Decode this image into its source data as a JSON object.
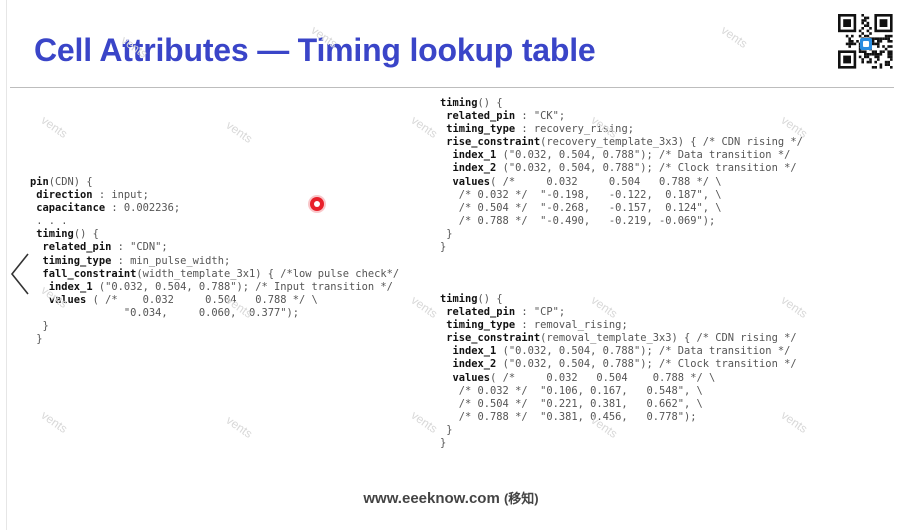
{
  "title": "Cell Attributes — Timing lookup table",
  "footer": {
    "site": "www.eeeknow.com",
    "cn": "(移知)"
  },
  "watermark_text": "vents",
  "left_block": [
    [
      {
        "k": "pin"
      },
      {
        "t": "(CDN) {"
      }
    ],
    [
      {
        "t": " "
      },
      {
        "k": "direction"
      },
      {
        "t": " : input;"
      }
    ],
    [
      {
        "t": " "
      },
      {
        "k": "capacitance"
      },
      {
        "t": " : 0.002236;"
      }
    ],
    [
      {
        "t": " . . ."
      }
    ],
    [
      {
        "t": " "
      },
      {
        "k": "timing"
      },
      {
        "t": "() {"
      }
    ],
    [
      {
        "t": "  "
      },
      {
        "k": "related_pin"
      },
      {
        "t": " : \"CDN\";"
      }
    ],
    [
      {
        "t": "  "
      },
      {
        "k": "timing_type"
      },
      {
        "t": " : min_pulse_width;"
      }
    ],
    [
      {
        "t": "  "
      },
      {
        "k": "fall_constraint"
      },
      {
        "t": "(width_template_3x1) { /*low pulse check*/"
      }
    ],
    [
      {
        "t": "   "
      },
      {
        "k": "index_1"
      },
      {
        "t": " (\"0.032, 0.504, 0.788\"); /* Input transition */"
      }
    ],
    [
      {
        "t": "   "
      },
      {
        "k": "values"
      },
      {
        "t": " ( /*    0.032     0.504   0.788 */ \\"
      }
    ],
    [
      {
        "t": "               \"0.034,     0.060,  0.377\");"
      }
    ],
    [
      {
        "t": "  }"
      }
    ],
    [
      {
        "t": " }"
      }
    ]
  ],
  "right_top_block": [
    [
      {
        "k": "timing"
      },
      {
        "t": "() {"
      }
    ],
    [
      {
        "t": " "
      },
      {
        "k": "related_pin"
      },
      {
        "t": " : \"CK\";"
      }
    ],
    [
      {
        "t": " "
      },
      {
        "k": "timing_type"
      },
      {
        "t": " : recovery_rising;"
      }
    ],
    [
      {
        "t": " "
      },
      {
        "k": "rise_constraint"
      },
      {
        "t": "(recovery_template_3x3) { /* CDN rising */"
      }
    ],
    [
      {
        "t": "  "
      },
      {
        "k": "index_1"
      },
      {
        "t": " (\"0.032, 0.504, 0.788\"); /* Data transition */"
      }
    ],
    [
      {
        "t": "  "
      },
      {
        "k": "index_2"
      },
      {
        "t": " (\"0.032, 0.504, 0.788\"); /* Clock transition */"
      }
    ],
    [
      {
        "t": "  "
      },
      {
        "k": "values"
      },
      {
        "t": "( /*     0.032     0.504   0.788 */ \\"
      }
    ],
    [
      {
        "t": "   /* 0.032 */  \"-0.198,   -0.122,  0.187\", \\"
      }
    ],
    [
      {
        "t": "   /* 0.504 */  \"-0.268,   -0.157,  0.124\", \\"
      }
    ],
    [
      {
        "t": "   /* 0.788 */  \"-0.490,   -0.219, -0.069\");"
      }
    ],
    [
      {
        "t": " }"
      }
    ],
    [
      {
        "t": "}"
      }
    ]
  ],
  "right_bottom_block": [
    [
      {
        "k": "timing"
      },
      {
        "t": "() {"
      }
    ],
    [
      {
        "t": " "
      },
      {
        "k": "related_pin"
      },
      {
        "t": " : \"CP\";"
      }
    ],
    [
      {
        "t": " "
      },
      {
        "k": "timing_type"
      },
      {
        "t": " : removal_rising;"
      }
    ],
    [
      {
        "t": " "
      },
      {
        "k": "rise_constraint"
      },
      {
        "t": "(removal_template_3x3) { /* CDN rising */"
      }
    ],
    [
      {
        "t": "  "
      },
      {
        "k": "index_1"
      },
      {
        "t": " (\"0.032, 0.504, 0.788\"); /* Data transition */"
      }
    ],
    [
      {
        "t": "  "
      },
      {
        "k": "index_2"
      },
      {
        "t": " (\"0.032, 0.504, 0.788\"); /* Clock transition */"
      }
    ],
    [
      {
        "t": "  "
      },
      {
        "k": "values"
      },
      {
        "t": "( /*     0.032   0.504    0.788 */ \\"
      }
    ],
    [
      {
        "t": "   /* 0.032 */  \"0.106, 0.167,   0.548\", \\"
      }
    ],
    [
      {
        "t": "   /* 0.504 */  \"0.221, 0.381,   0.662\", \\"
      }
    ],
    [
      {
        "t": "   /* 0.788 */  \"0.381, 0.456,   0.778\");"
      }
    ],
    [
      {
        "t": " }"
      }
    ],
    [
      {
        "t": "}"
      }
    ]
  ]
}
